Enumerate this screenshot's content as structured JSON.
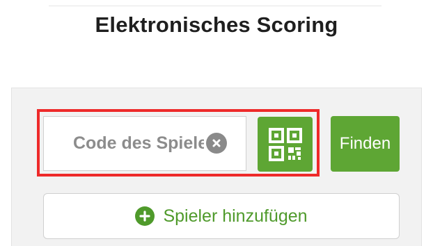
{
  "header": {
    "title": "Elektronisches Scoring"
  },
  "search": {
    "placeholder": "Code des Spielers",
    "value": "",
    "clear_icon": "close-circle-icon",
    "qr_icon": "qr-code-icon",
    "find_label": "Finden"
  },
  "actions": {
    "add_player_label": "Spieler hinzufügen",
    "add_player_icon": "plus-circle-icon"
  },
  "colors": {
    "accent": "#5ea634",
    "highlight": "#ee2a2a",
    "panel_background": "#f2f2f2",
    "title_text": "#1f1f1f"
  }
}
